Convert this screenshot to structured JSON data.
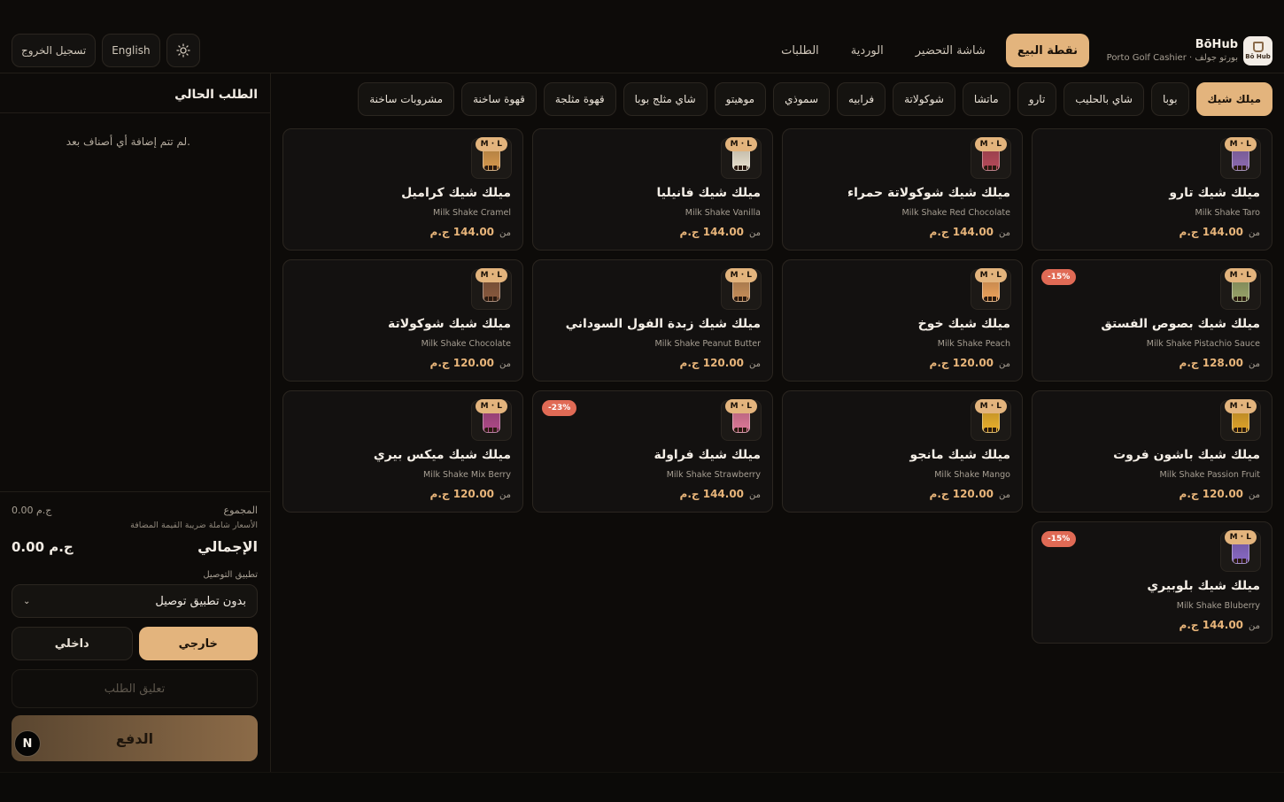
{
  "brand": {
    "name": "BōHub",
    "subtitle": "Porto Golf Cashier · بورتو جولف",
    "logo_text": "Bō Hub"
  },
  "nav": {
    "items": [
      "نقطة البيع",
      "شاشة التحضير",
      "الوردية",
      "الطلبات"
    ],
    "active_index": 0
  },
  "header_actions": {
    "logout": "تسجيل الخروج",
    "language": "English",
    "theme_icon": "sun-icon"
  },
  "categories": {
    "items": [
      "ميلك شيك",
      "بوبا",
      "شاي بالحليب",
      "تارو",
      "ماتشا",
      "شوكولاتة",
      "فرابيه",
      "سموذي",
      "موهيتو",
      "شاي مثلج بوبا",
      "قهوة مثلجة",
      "قهوة ساخنة",
      "مشروبات ساخنة"
    ],
    "active_index": 0
  },
  "products": [
    {
      "name_ar": "ميلك شيك تارو",
      "name_en": "Milk Shake Taro",
      "from": "من",
      "price": "144.00 ج.م",
      "sizes": "M · L",
      "discount": "",
      "color": "#8e6bb3"
    },
    {
      "name_ar": "ميلك شيك شوكولاتة حمراء",
      "name_en": "Milk Shake Red Chocolate",
      "from": "من",
      "price": "144.00 ج.م",
      "sizes": "M · L",
      "discount": "",
      "color": "#b84a5a"
    },
    {
      "name_ar": "ميلك شيك فانيليا",
      "name_en": "Milk Shake Vanilla",
      "from": "من",
      "price": "144.00 ج.م",
      "sizes": "M · L",
      "discount": "",
      "color": "#ece3cf"
    },
    {
      "name_ar": "ميلك شيك كراميل",
      "name_en": "Milk Shake Cramel",
      "from": "من",
      "price": "144.00 ج.م",
      "sizes": "M · L",
      "discount": "",
      "color": "#d89a4e"
    },
    {
      "name_ar": "ميلك شيك بصوص الفستق",
      "name_en": "Milk Shake Pistachio Sauce",
      "from": "من",
      "price": "128.00 ج.م",
      "sizes": "M · L",
      "discount": "-15%",
      "color": "#9aa56a"
    },
    {
      "name_ar": "ميلك شيك خوخ",
      "name_en": "Milk Shake Peach",
      "from": "من",
      "price": "120.00 ج.م",
      "sizes": "M · L",
      "discount": "",
      "color": "#f0a45c"
    },
    {
      "name_ar": "ميلك شيك زبدة الفول السوداني",
      "name_en": "Milk Shake Peanut Butter",
      "from": "من",
      "price": "120.00 ج.م",
      "sizes": "M · L",
      "discount": "",
      "color": "#c9905a"
    },
    {
      "name_ar": "ميلك شيك شوكولاتة",
      "name_en": "Milk Shake Chocolate",
      "from": "من",
      "price": "120.00 ج.م",
      "sizes": "M · L",
      "discount": "",
      "color": "#8a5a3e"
    },
    {
      "name_ar": "ميلك شيك باشون فروت",
      "name_en": "Milk Shake Passion Fruit",
      "from": "من",
      "price": "120.00 ج.م",
      "sizes": "M · L",
      "discount": "",
      "color": "#e2a52a"
    },
    {
      "name_ar": "ميلك شيك مانجو",
      "name_en": "Milk Shake Mango",
      "from": "من",
      "price": "120.00 ج.م",
      "sizes": "M · L",
      "discount": "",
      "color": "#eeb22c"
    },
    {
      "name_ar": "ميلك شيك فراولة",
      "name_en": "Milk Shake Strawberry",
      "from": "من",
      "price": "144.00 ج.م",
      "sizes": "M · L",
      "discount": "-23%",
      "color": "#e07a9a"
    },
    {
      "name_ar": "ميلك شيك ميكس بيري",
      "name_en": "Milk Shake Mix Berry",
      "from": "من",
      "price": "120.00 ج.م",
      "sizes": "M · L",
      "discount": "",
      "color": "#b04a8a"
    },
    {
      "name_ar": "ميلك شيك بلوبيري",
      "name_en": "Milk Shake Bluberry",
      "from": "من",
      "price": "144.00 ج.م",
      "sizes": "M · L",
      "discount": "-15%",
      "color": "#8a6ac8"
    }
  ],
  "order": {
    "title": "الطلب الحالي",
    "empty_message": "لم تتم إضافة أي أصناف بعد.",
    "subtotal_label": "المجموع",
    "subtotal_value": "0.00 ج.م",
    "vat_note": "الأسعار شاملة ضريبة القيمة المضافة",
    "total_label": "الإجمالي",
    "total_value": "0.00 ج.م",
    "delivery_label": "تطبيق التوصيل",
    "delivery_value": "بدون تطبيق توصيل",
    "type_options": [
      "خارجي",
      "داخلي"
    ],
    "type_active_index": 0,
    "comment_placeholder": "تعليق الطلب",
    "pay_label": "الدفع",
    "floating_badge": "N"
  },
  "colors": {
    "accent": "#e3b47d",
    "background": "#0d0b09",
    "discount": "#e06a55"
  }
}
